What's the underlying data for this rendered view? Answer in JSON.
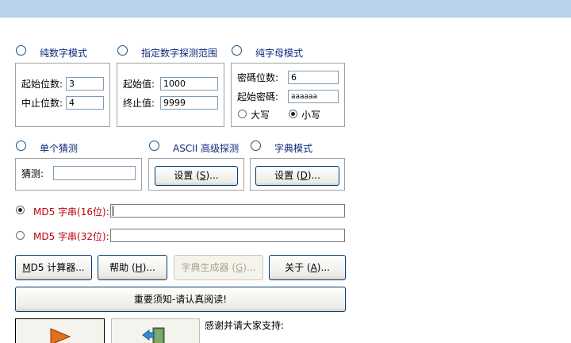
{
  "modes": {
    "numeric": "纯数字模式",
    "range": "指定数字探测范围",
    "alpha": "纯字母模式",
    "single": "单个猜测",
    "ascii": "ASCII 高级探测",
    "dict": "字典模式"
  },
  "numeric": {
    "start_label": "起始位数:",
    "start_value": "3",
    "end_label": "中止位数:",
    "end_value": "4"
  },
  "range": {
    "start_label": "起始值:",
    "start_value": "1000",
    "end_label": "终止值:",
    "end_value": "9999"
  },
  "alpha": {
    "len_label": "密碼位数:",
    "len_value": "6",
    "start_label": "起始密碼:",
    "start_value": "aaaaaa",
    "upper_label": "大写",
    "lower_label": "小写"
  },
  "single": {
    "guess_label": "猜测:",
    "guess_value": ""
  },
  "ascii": {
    "settings_prefix": "设置 (",
    "settings_key": "S",
    "settings_suffix": ")..."
  },
  "dict": {
    "settings_prefix": "设置 (",
    "settings_key": "D",
    "settings_suffix": ")..."
  },
  "md5": {
    "label16": "MD5 字串(16位):",
    "value16": "",
    "label32": "MD5 字串(32位):",
    "value32": ""
  },
  "buttons": {
    "calc_key": "M",
    "calc_rest": "D5 计算器...",
    "help_prefix": "帮助 (",
    "help_key": "H",
    "help_suffix": ")...",
    "gen_prefix": "字典生成器 (",
    "gen_key": "G",
    "gen_suffix": ")...",
    "about_prefix": "关于 (",
    "about_key": "A",
    "about_suffix": ")...",
    "notice": "重要须知-请认真阅读!"
  },
  "thanks": "感谢并请大家支持:",
  "colors": {
    "topbar": "#b9d1ea",
    "mode_label": "#0f2a7a",
    "md5_label": "#c0000b",
    "button_border": "#003c74"
  }
}
